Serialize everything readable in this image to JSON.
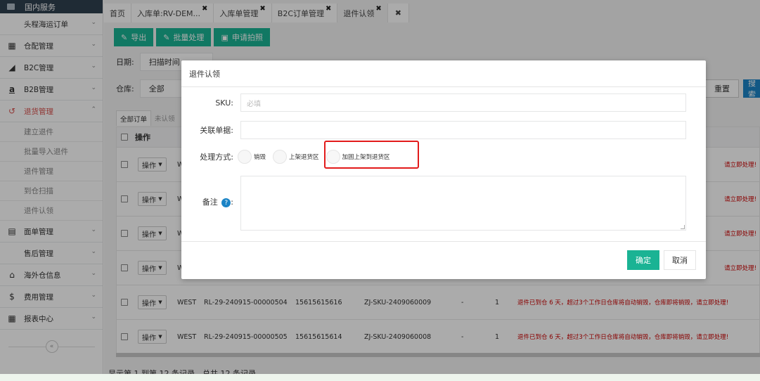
{
  "sidebar": {
    "top_item": "国内服务",
    "items": [
      {
        "label": "头程海运订单",
        "icon": "none-icon",
        "has_icon": false
      },
      {
        "label": "仓配管理",
        "icon": "grid-icon",
        "has_icon": true
      },
      {
        "label": "B2C管理",
        "icon": "cart-icon",
        "has_icon": true
      },
      {
        "label": "B2B管理",
        "icon": "amazon-icon",
        "has_icon": true
      },
      {
        "label": "退货管理",
        "icon": "return-icon",
        "has_icon": true,
        "active": true
      }
    ],
    "sub_items": [
      "建立退件",
      "批量导入退件",
      "退件管理",
      "到仓扫描",
      "退件认领"
    ],
    "items_after": [
      {
        "label": "面单管理",
        "icon": "document-icon"
      },
      {
        "label": "售后管理",
        "icon": "none-icon"
      },
      {
        "label": "海外仓信息",
        "icon": "home-icon"
      },
      {
        "label": "费用管理",
        "icon": "dollar-icon"
      },
      {
        "label": "报表中心",
        "icon": "table-icon"
      }
    ],
    "collapse_icon": "«"
  },
  "tabs": [
    {
      "label": "首页",
      "closable": false
    },
    {
      "label": "入库单:RV-DEM...",
      "closable": true
    },
    {
      "label": "入库单管理",
      "closable": true
    },
    {
      "label": "B2C订单管理",
      "closable": true
    },
    {
      "label": "退件认领",
      "closable": true,
      "active": true
    }
  ],
  "tab_close_all": "✖",
  "toolbar": {
    "export": "导出",
    "batch": "批量处理",
    "photo": "申请拍照"
  },
  "filters": {
    "date_label": "日期:",
    "date_value": "扫描时间",
    "warehouse_label": "仓库:",
    "warehouse_value": "全部",
    "reset": "重置",
    "search": "搜索"
  },
  "subtabs": [
    "全部订单",
    "未认领"
  ],
  "table": {
    "header_op": "操作",
    "op_button": "操作",
    "rows": [
      {
        "warehouse": "W",
        "code": "",
        "phone": "",
        "sku": "",
        "dash": "",
        "qty": "",
        "alert": "请立即处理!"
      },
      {
        "warehouse": "W",
        "code": "",
        "phone": "",
        "sku": "",
        "dash": "",
        "qty": "",
        "alert": "请立即处理!"
      },
      {
        "warehouse": "W",
        "code": "",
        "phone": "",
        "sku": "",
        "dash": "",
        "qty": "",
        "alert": "请立即处理!"
      },
      {
        "warehouse": "W",
        "code": "",
        "phone": "",
        "sku": "",
        "dash": "",
        "qty": "",
        "alert": "请立即处理!"
      },
      {
        "warehouse": "WEST",
        "code": "RL-29-240915-00000504",
        "phone": "15615615616",
        "sku": "ZJ-SKU-2409060009",
        "dash": "-",
        "qty": "1",
        "alert": "退件已到仓 6 天，超过3个工作日仓库将自动销毁，仓库即将销毁，请立即处理!"
      },
      {
        "warehouse": "WEST",
        "code": "RL-29-240915-00000505",
        "phone": "15615615614",
        "sku": "ZJ-SKU-2409060008",
        "dash": "-",
        "qty": "1",
        "alert": "退件已到仓 6 天，超过3个工作日仓库将自动销毁，仓库即将销毁，请立即处理!"
      }
    ]
  },
  "footer": "显示第 1 到第 12 条记录，总共 12 条记录",
  "modal": {
    "title": "退件认领",
    "sku_label": "SKU:",
    "sku_placeholder": "必填",
    "ref_label": "关联单据:",
    "method_label": "处理方式:",
    "options": [
      "销毁",
      "上架退货区",
      "加固上架到退货区"
    ],
    "remark_label": "备注",
    "ok": "确定",
    "cancel": "取消"
  },
  "colors": {
    "primary_green": "#1ab394",
    "primary_blue": "#1c84c6",
    "alert_red": "#cc0000",
    "highlight_red": "#e21b1b",
    "sidebar_dark": "#2f4050"
  }
}
